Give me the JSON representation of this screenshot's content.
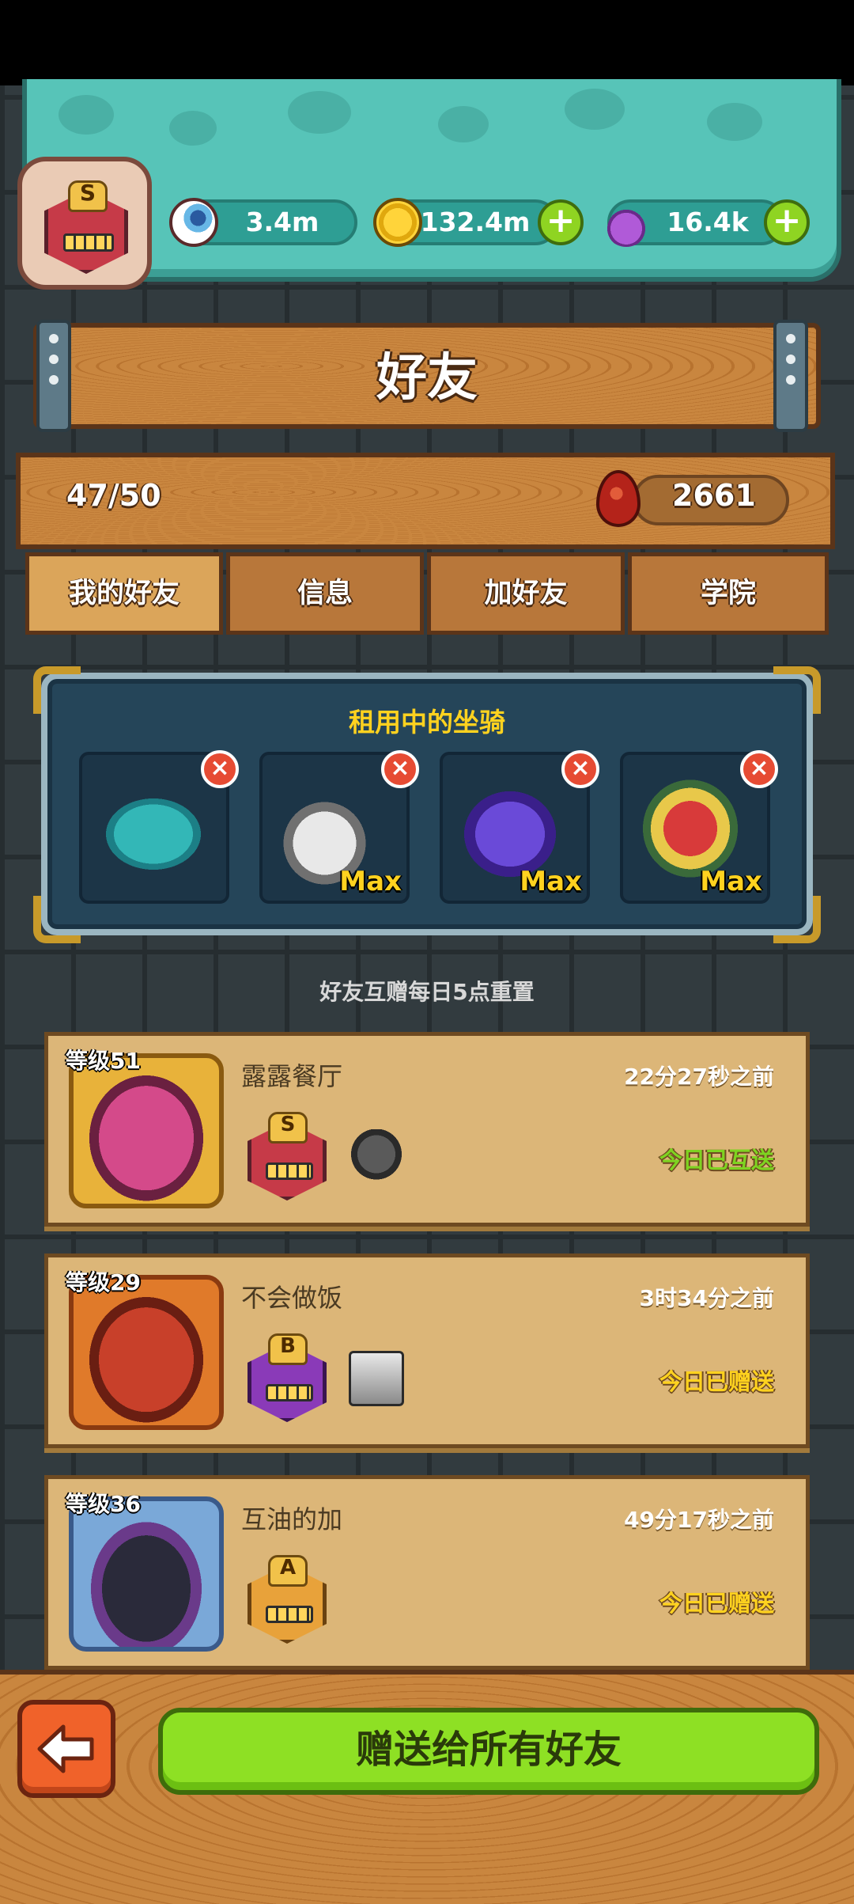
{
  "resources": {
    "eyeballs": "3.4m",
    "coins": "132.4m",
    "potions": "16.4k",
    "plus_symbol": "+"
  },
  "player_rank": "S",
  "page_title": "好友",
  "friend_count": "47/50",
  "blood_points": "2661",
  "tabs": [
    "我的好友",
    "信息",
    "加好友",
    "学院"
  ],
  "active_tab": "我的好友",
  "mounts": {
    "title": "租用中的坐骑",
    "close_symbol": "×",
    "slots": [
      {
        "max": ""
      },
      {
        "max": "Max"
      },
      {
        "max": "Max"
      },
      {
        "max": "Max"
      }
    ]
  },
  "reset_note": "好友互赠每日5点重置",
  "friends": [
    {
      "level": "等级51",
      "name": "露露餐厅",
      "time": "22分27秒之前",
      "status": "今日已互送",
      "rank": "S"
    },
    {
      "level": "等级29",
      "name": "不会做饭",
      "time": "3时34分之前",
      "status": "今日已赠送",
      "rank": "B"
    },
    {
      "level": "等级36",
      "name": "互油的加",
      "time": "49分17秒之前",
      "status": "今日已赠送",
      "rank": "A"
    }
  ],
  "send_all_label": "赠送给所有好友",
  "colors": {
    "accent_green": "#8ee024",
    "status_yellow": "#ffd21f",
    "banner_teal": "#57c4b8",
    "wood": "#c4803a"
  },
  "icons": [
    "eyeball-icon",
    "coin-icon",
    "potion-icon",
    "plus-icon",
    "blood-drop-icon",
    "close-icon",
    "back-arrow-icon"
  ]
}
